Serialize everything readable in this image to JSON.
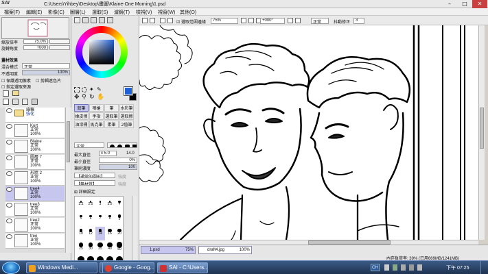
{
  "window": {
    "logo_text": "SAI",
    "title": "C:\\Users\\Yihbey\\Desktop\\畫圖\\Klaine-One Morning\\1.psd",
    "controls": [
      "–",
      "□",
      "✕"
    ]
  },
  "menu": [
    "檔案(F)",
    "編輯(E)",
    "影像(C)",
    "圖層(L)",
    "選取(S)",
    "濾鏡(T)",
    "檢視(V)",
    "視窗(W)",
    "其他(O)"
  ],
  "navigator": {
    "zoom_label": "縮放倍率",
    "zoom_value": "75.0%",
    "rotate_label": "旋轉角度",
    "rotate_value": "+000"
  },
  "layer_effects": {
    "title": "畫材效果",
    "blend_label": "混合模式",
    "blend_value": "正常",
    "opacity_label": "不透明度",
    "opacity_value": "100%",
    "protect_alpha": "保護透明像素",
    "clip_group": "剪輯遮色片",
    "selection_source": "指定選取來源"
  },
  "layers": [
    {
      "name": "綠稿",
      "mode": "強化",
      "opacity": "",
      "folder": true,
      "sel": false
    },
    {
      "name": "Kurt",
      "mode": "正常",
      "opacity": "100%",
      "sel": false
    },
    {
      "name": "Blaine",
      "mode": "正常",
      "opacity": "100%",
      "sel": false
    },
    {
      "name": "圖層 7",
      "mode": "正常",
      "opacity": "100%",
      "sel": false
    },
    {
      "name": "形狀 2",
      "mode": "正常",
      "opacity": "100%",
      "sel": false
    },
    {
      "name": "tree4",
      "mode": "正常",
      "opacity": "100%",
      "sel": true
    },
    {
      "name": "tree3",
      "mode": "正常",
      "opacity": "100%",
      "sel": false
    },
    {
      "name": "tree2",
      "mode": "正常",
      "opacity": "100%",
      "sel": false
    },
    {
      "name": "tree",
      "mode": "正常",
      "opacity": "100%",
      "sel": false
    }
  ],
  "colors": {
    "primary": "#1f5fd6",
    "secondary": "#000000"
  },
  "tools": [
    [
      "鉛筆",
      "噴槍",
      "筆",
      "水彩筆"
    ],
    [
      "橡皮擦",
      "手指",
      "選取筆",
      "選取擦"
    ],
    [
      "油漆桶",
      "馬克筆",
      "柔筆",
      "2值筆"
    ]
  ],
  "brush": {
    "mode": "正常",
    "max_size_label": "最大直徑",
    "max_size_mult": "x 5.0",
    "max_size_value": "14.0",
    "min_size_label": "最小直徑",
    "min_size_value": "0%",
    "density_label": "筆刷濃度",
    "density_value": "100",
    "shape": "【通常的圓形】",
    "shape_strength": "強度",
    "texture": "【無材質】",
    "texture_strength": "強度",
    "detail": "詳細設定"
  },
  "brush_sizes": [
    [
      "2.3",
      "2.5",
      "3",
      "3.5",
      "4"
    ],
    [
      "5",
      "6",
      "7",
      "8",
      "9"
    ],
    [
      "10",
      "12",
      "14",
      "16",
      "20"
    ],
    [
      "25",
      "30",
      "35",
      "40",
      "50"
    ],
    [
      "60",
      "70",
      "80",
      "100",
      "120"
    ]
  ],
  "brush_size_selected": "14",
  "toolbar": {
    "antialias": "選取范圍邊緣",
    "zoom": "75%",
    "rotate": "+000°",
    "blend": "正常",
    "stabilizer_label": "抖動修正",
    "stabilizer_value": "3"
  },
  "documents": [
    {
      "name": "1.psd",
      "zoom": "75%",
      "active": true
    },
    {
      "name": "draft4.jpg",
      "zoom": "100%",
      "active": false
    }
  ],
  "status": "內存負荷率: 39% (已用669MB/1241MB)",
  "taskbar": {
    "tasks": [
      "Windows Medi...",
      "",
      "Google - Goog...",
      "SAI - C:\\Users..."
    ],
    "task_colors": [
      "#f0a020",
      "#2a6ad0",
      "#e04030",
      "#d03030"
    ],
    "ime": "CH",
    "clock": "下午 07:25"
  }
}
